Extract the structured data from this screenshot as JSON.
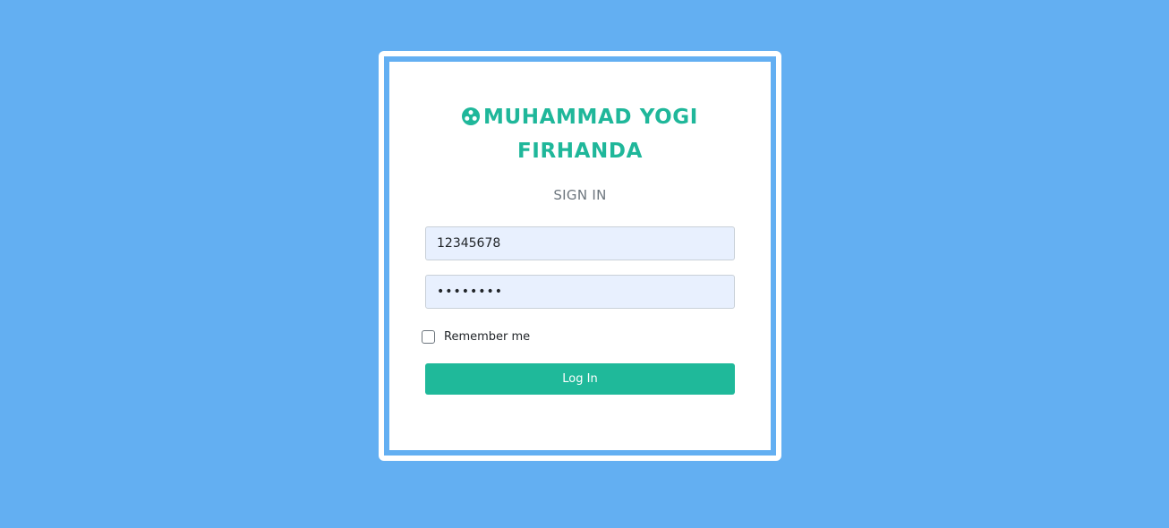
{
  "brand": {
    "icon": "dots-circle-icon",
    "title": "MUHAMMAD YOGI FIRHANDA",
    "color": "#1fb79a"
  },
  "form": {
    "heading": "SIGN IN",
    "username_value": "12345678",
    "password_value": "••••••••",
    "remember_label": "Remember me",
    "remember_checked": false,
    "submit_label": "Log In"
  },
  "colors": {
    "background": "#63aff2",
    "accent": "#1fb99a",
    "input_fill": "#e8f0fe"
  }
}
